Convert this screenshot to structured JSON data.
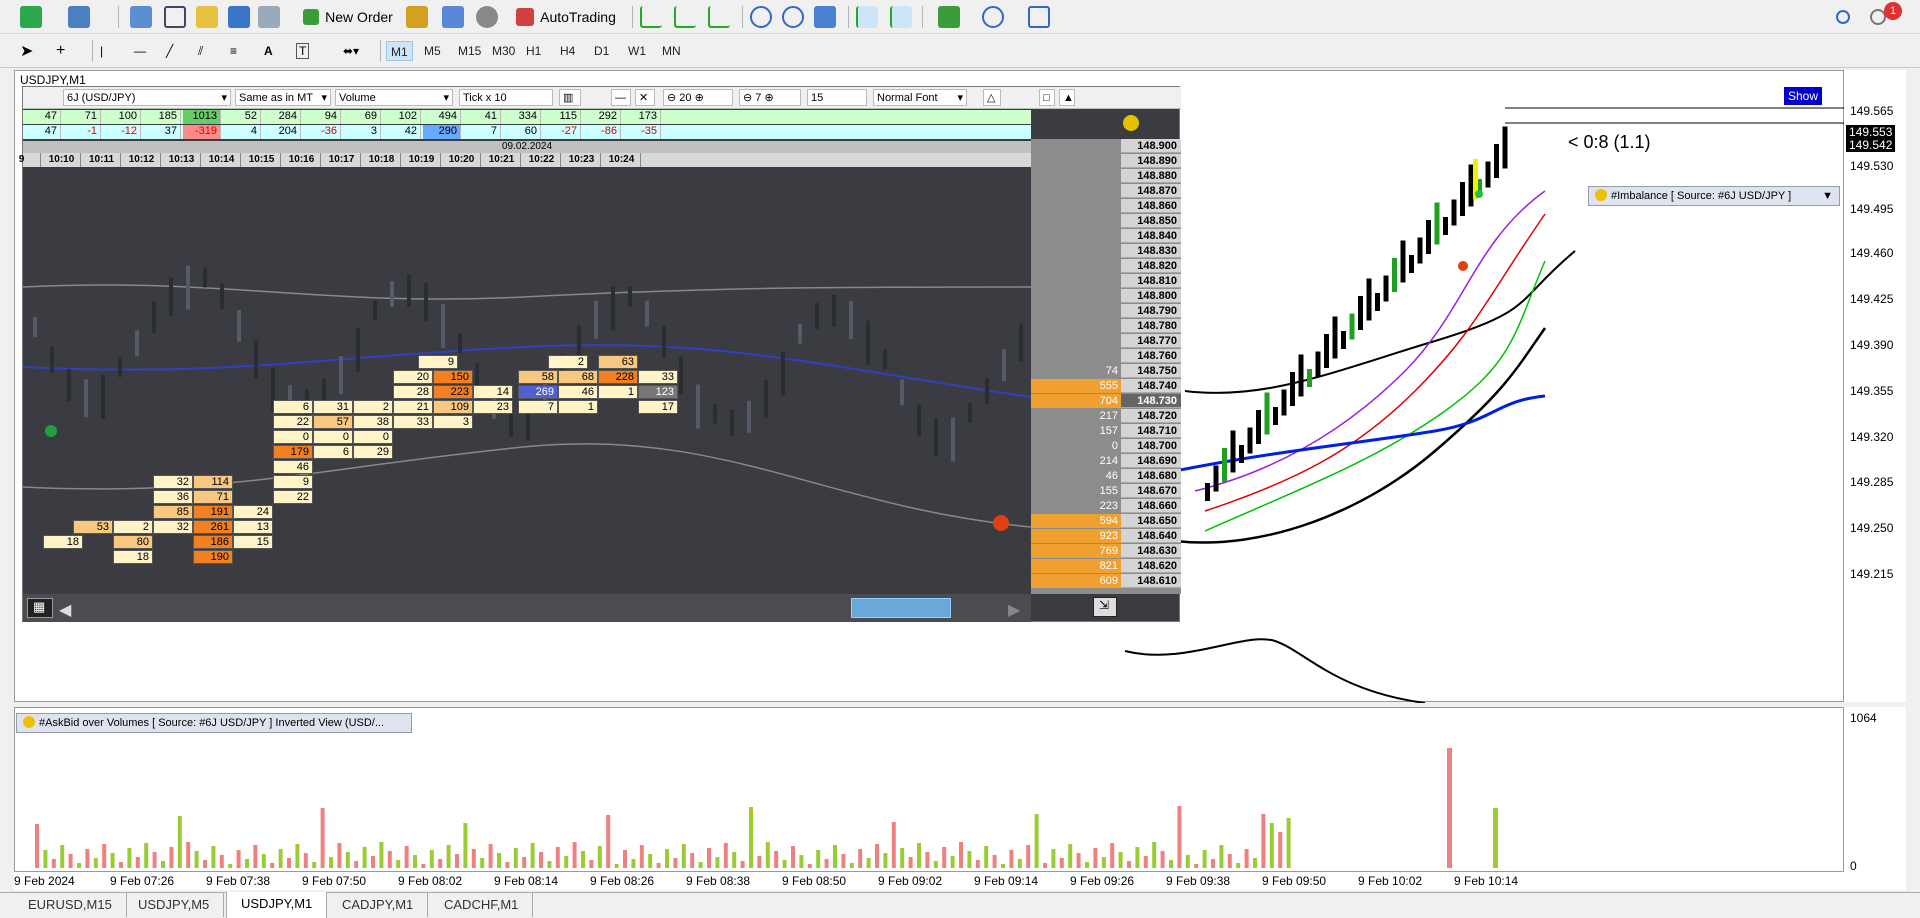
{
  "toolbar": {
    "new_order": "New Order",
    "autotrading": "AutoTrading",
    "notification_count": "1"
  },
  "timeframes": [
    "M1",
    "M5",
    "M15",
    "M30",
    "H1",
    "H4",
    "D1",
    "W1",
    "MN"
  ],
  "selected_timeframe": "M1",
  "chart": {
    "title": "USDJPY,M1",
    "show_button": "Show",
    "ratio_label": "< 0:8 (1.1)",
    "imbalance_label": "#Imbalance [ Source: #6J USD/JPY ]",
    "price_labels": [
      "149.565",
      "149.553",
      "149.542",
      "149.530",
      "149.495",
      "149.460",
      "149.425",
      "149.390",
      "149.355",
      "149.320",
      "149.285",
      "149.250",
      "149.215"
    ]
  },
  "subchart": {
    "title": "#AskBid over Volumes [ Source: #6J USD/JPY ] Inverted View (USD/...",
    "max_label": "1064",
    "min_label": "0"
  },
  "time_axis": [
    "9 Feb 2024",
    "9 Feb 07:26",
    "9 Feb 07:38",
    "9 Feb 07:50",
    "9 Feb 08:02",
    "9 Feb 08:14",
    "9 Feb 08:26",
    "9 Feb 08:38",
    "9 Feb 08:50",
    "9 Feb 09:02",
    "9 Feb 09:14",
    "9 Feb 09:26",
    "9 Feb 09:38",
    "9 Feb 09:50",
    "9 Feb 10:02",
    "9 Feb 10:14"
  ],
  "tabs": [
    "EURUSD,M15",
    "USDJPY,M5",
    "USDJPY,M1",
    "CADJPY,M1",
    "CADCHF,M1"
  ],
  "active_tab": "USDJPY,M1",
  "panel": {
    "instrument": "6J (USD/JPY)",
    "mode": "Same as in MT",
    "type": "Volume",
    "tick": "Tick x 10",
    "zoom": "20",
    "rows": "7",
    "level": "15",
    "font": "Normal Font",
    "date": "09.02.2024",
    "times": [
      "9",
      "10:10",
      "10:11",
      "10:12",
      "10:13",
      "10:14",
      "10:15",
      "10:16",
      "10:17",
      "10:18",
      "10:19",
      "10:20",
      "10:21",
      "10:22",
      "10:23",
      "10:24"
    ],
    "row1": [
      "47",
      "71",
      "100",
      "185",
      "1013",
      "52",
      "284",
      "94",
      "69",
      "102",
      "494",
      "41",
      "334",
      "115",
      "292",
      "173"
    ],
    "row2": [
      "47",
      "-1",
      "-12",
      "37",
      "-319",
      "4",
      "204",
      "-36",
      "3",
      "42",
      "290",
      "7",
      "60",
      "-27",
      "-86",
      "-35"
    ],
    "ladder_prices": [
      "148.900",
      "148.890",
      "148.880",
      "148.870",
      "148.860",
      "148.850",
      "148.840",
      "148.830",
      "148.820",
      "148.810",
      "148.800",
      "148.790",
      "148.780",
      "148.770",
      "148.760",
      "148.750",
      "148.740",
      "148.730",
      "148.720",
      "148.710",
      "148.700",
      "148.690",
      "148.680",
      "148.670",
      "148.660",
      "148.650",
      "148.640",
      "148.630",
      "148.620",
      "148.610"
    ],
    "ladder_volumes": [
      "",
      "",
      "",
      "",
      "",
      "",
      "",
      "",
      "",
      "",
      "",
      "",
      "",
      "",
      "",
      "74",
      "555",
      "704",
      "217",
      "157",
      "0",
      "214",
      "46",
      "155",
      "223",
      "594",
      "923",
      "769",
      "821",
      "609"
    ]
  },
  "colors": {
    "up": "#2e8b00",
    "down": "#e00000",
    "accent": "#0000cc"
  }
}
